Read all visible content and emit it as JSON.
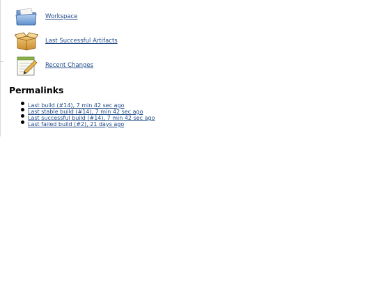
{
  "tasks": [
    {
      "icon": "folder-icon",
      "label": "Workspace"
    },
    {
      "icon": "artifact-box-icon",
      "label": "Last Successful Artifacts"
    },
    {
      "icon": "notepad-icon",
      "label": "Recent Changes"
    }
  ],
  "permalinks": {
    "title": "Permalinks",
    "items": [
      "Last build (#14), 7 min 42 sec ago",
      "Last stable build (#14), 7 min 42 sec ago",
      "Last successful build (#14), 7 min 42 sec ago",
      "Last failed build (#2), 21 days ago"
    ]
  }
}
